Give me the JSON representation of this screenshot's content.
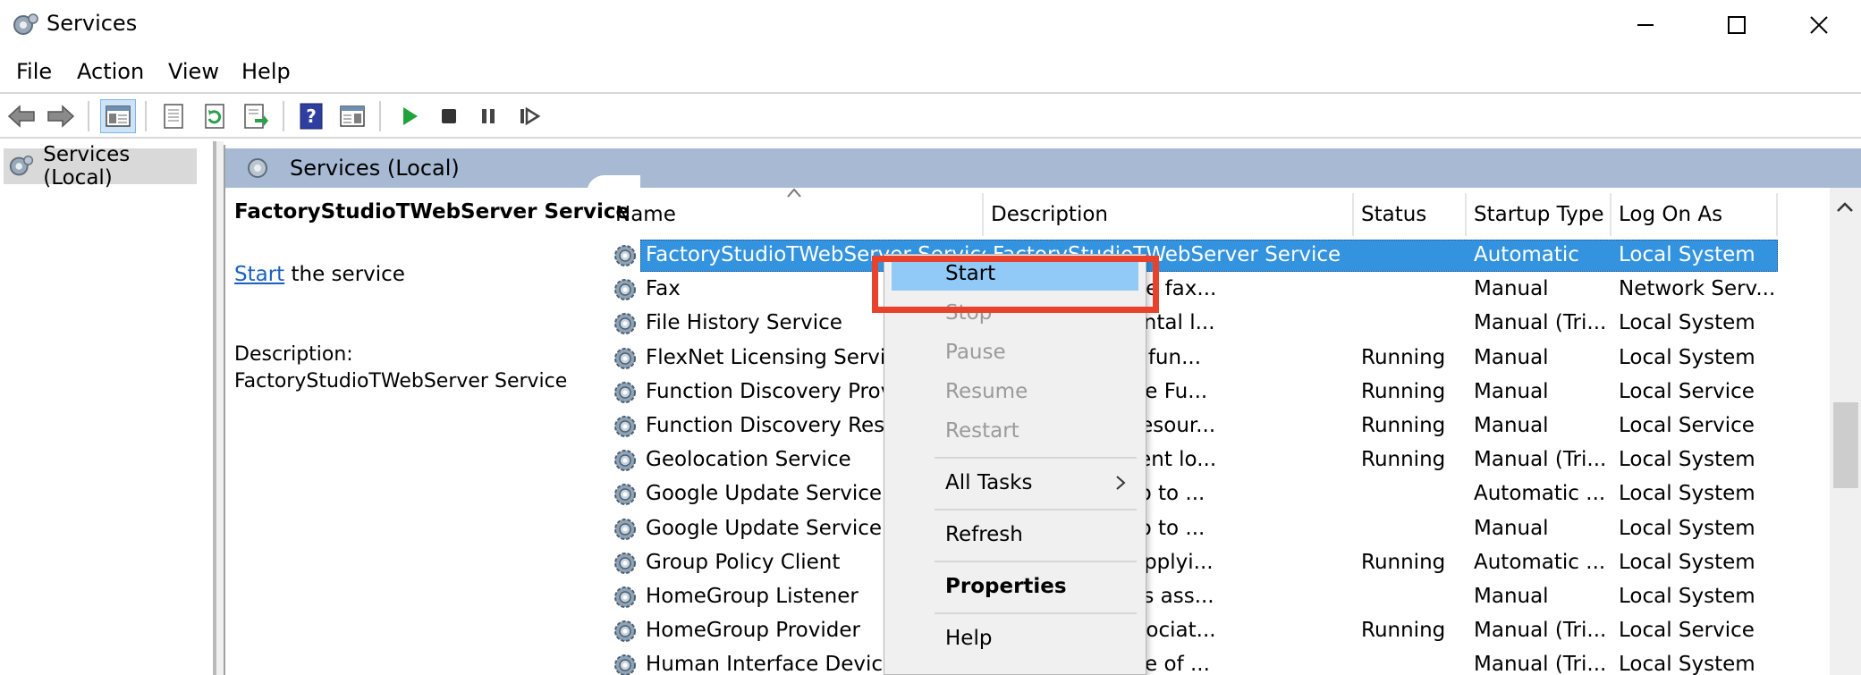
{
  "window": {
    "title": "Services",
    "icon": "services-gear-icon"
  },
  "menubar": {
    "items": [
      "File",
      "Action",
      "View",
      "Help"
    ]
  },
  "toolbar": {
    "icons": [
      "back-arrow-icon",
      "forward-arrow-icon",
      "show-console-tree-icon",
      "properties-icon",
      "refresh-icon",
      "export-list-icon",
      "help-icon",
      "show-action-pane-icon",
      "start-service-icon",
      "stop-service-icon",
      "pause-service-icon",
      "restart-service-icon"
    ]
  },
  "tree": {
    "root_label": "Services (Local)"
  },
  "pane": {
    "header_label": "Services (Local)"
  },
  "detail": {
    "service_name": "FactoryStudioTWebServer Service",
    "start_link": "Start",
    "start_suffix": " the service",
    "description_label": "Description:",
    "description_value": "FactoryStudioTWebServer Service"
  },
  "table": {
    "columns": [
      "Name",
      "Description",
      "Status",
      "Startup Type",
      "Log On As"
    ],
    "rows": [
      {
        "name": "FactoryStudioTWebServer Service",
        "description": "FactoryStudioTWebServer Service",
        "status": "",
        "startup": "Automatic",
        "logon": "Local System",
        "selected": true
      },
      {
        "name": "Fax",
        "description": "end and receive fax...",
        "status": "",
        "startup": "Manual",
        "logon": "Network Serv..."
      },
      {
        "name": "File History Service",
        "description": "es from accidental l...",
        "status": "",
        "startup": "Manual (Tri...",
        "logon": "Local System"
      },
      {
        "name": "FlexNet Licensing Service",
        "description": "orms licensing fun...",
        "status": "Running",
        "startup": "Manual",
        "logon": "Local System"
      },
      {
        "name": "Function Discovery Provid",
        "description": "ervice hosts the Fu...",
        "status": "Running",
        "startup": "Manual",
        "logon": "Local Service"
      },
      {
        "name": "Function Discovery Resou",
        "description": "omputer and resour...",
        "status": "Running",
        "startup": "Manual",
        "logon": "Local Service"
      },
      {
        "name": "Geolocation Service",
        "description": "nitors the current lo...",
        "status": "Running",
        "startup": "Manual (Tri...",
        "logon": "Local System"
      },
      {
        "name": "Google Update Service (g",
        "description": "gle software up to ...",
        "status": "",
        "startup": "Automatic ...",
        "logon": "Local System"
      },
      {
        "name": "Google Update Service (g",
        "description": "gle software up to ...",
        "status": "",
        "startup": "Manual",
        "logon": "Local System"
      },
      {
        "name": "Group Policy Client",
        "description": "sponsible for applyi...",
        "status": "Running",
        "startup": "Automatic ...",
        "logon": "Local System"
      },
      {
        "name": "HomeGroup Listener",
        "description": "nputer changes ass...",
        "status": "",
        "startup": "Manual",
        "logon": "Local System"
      },
      {
        "name": "HomeGroup Provider",
        "description": "rking tasks associat...",
        "status": "Running",
        "startup": "Manual (Tri...",
        "logon": "Local Service"
      },
      {
        "name": "Human Interface Device S",
        "description": "aintains the use of ...",
        "status": "",
        "startup": "Manual (Tri...",
        "logon": "Local System"
      }
    ]
  },
  "context_menu": {
    "start": "Start",
    "stop": "Stop",
    "pause": "Pause",
    "resume": "Resume",
    "restart": "Restart",
    "all_tasks": "All Tasks",
    "refresh": "Refresh",
    "properties": "Properties",
    "help": "Help"
  },
  "colors": {
    "selection": "#3393df",
    "menu_hover": "#91c9f7",
    "highlight_box": "#e8412c",
    "pane_header": "#a7b9d3"
  }
}
